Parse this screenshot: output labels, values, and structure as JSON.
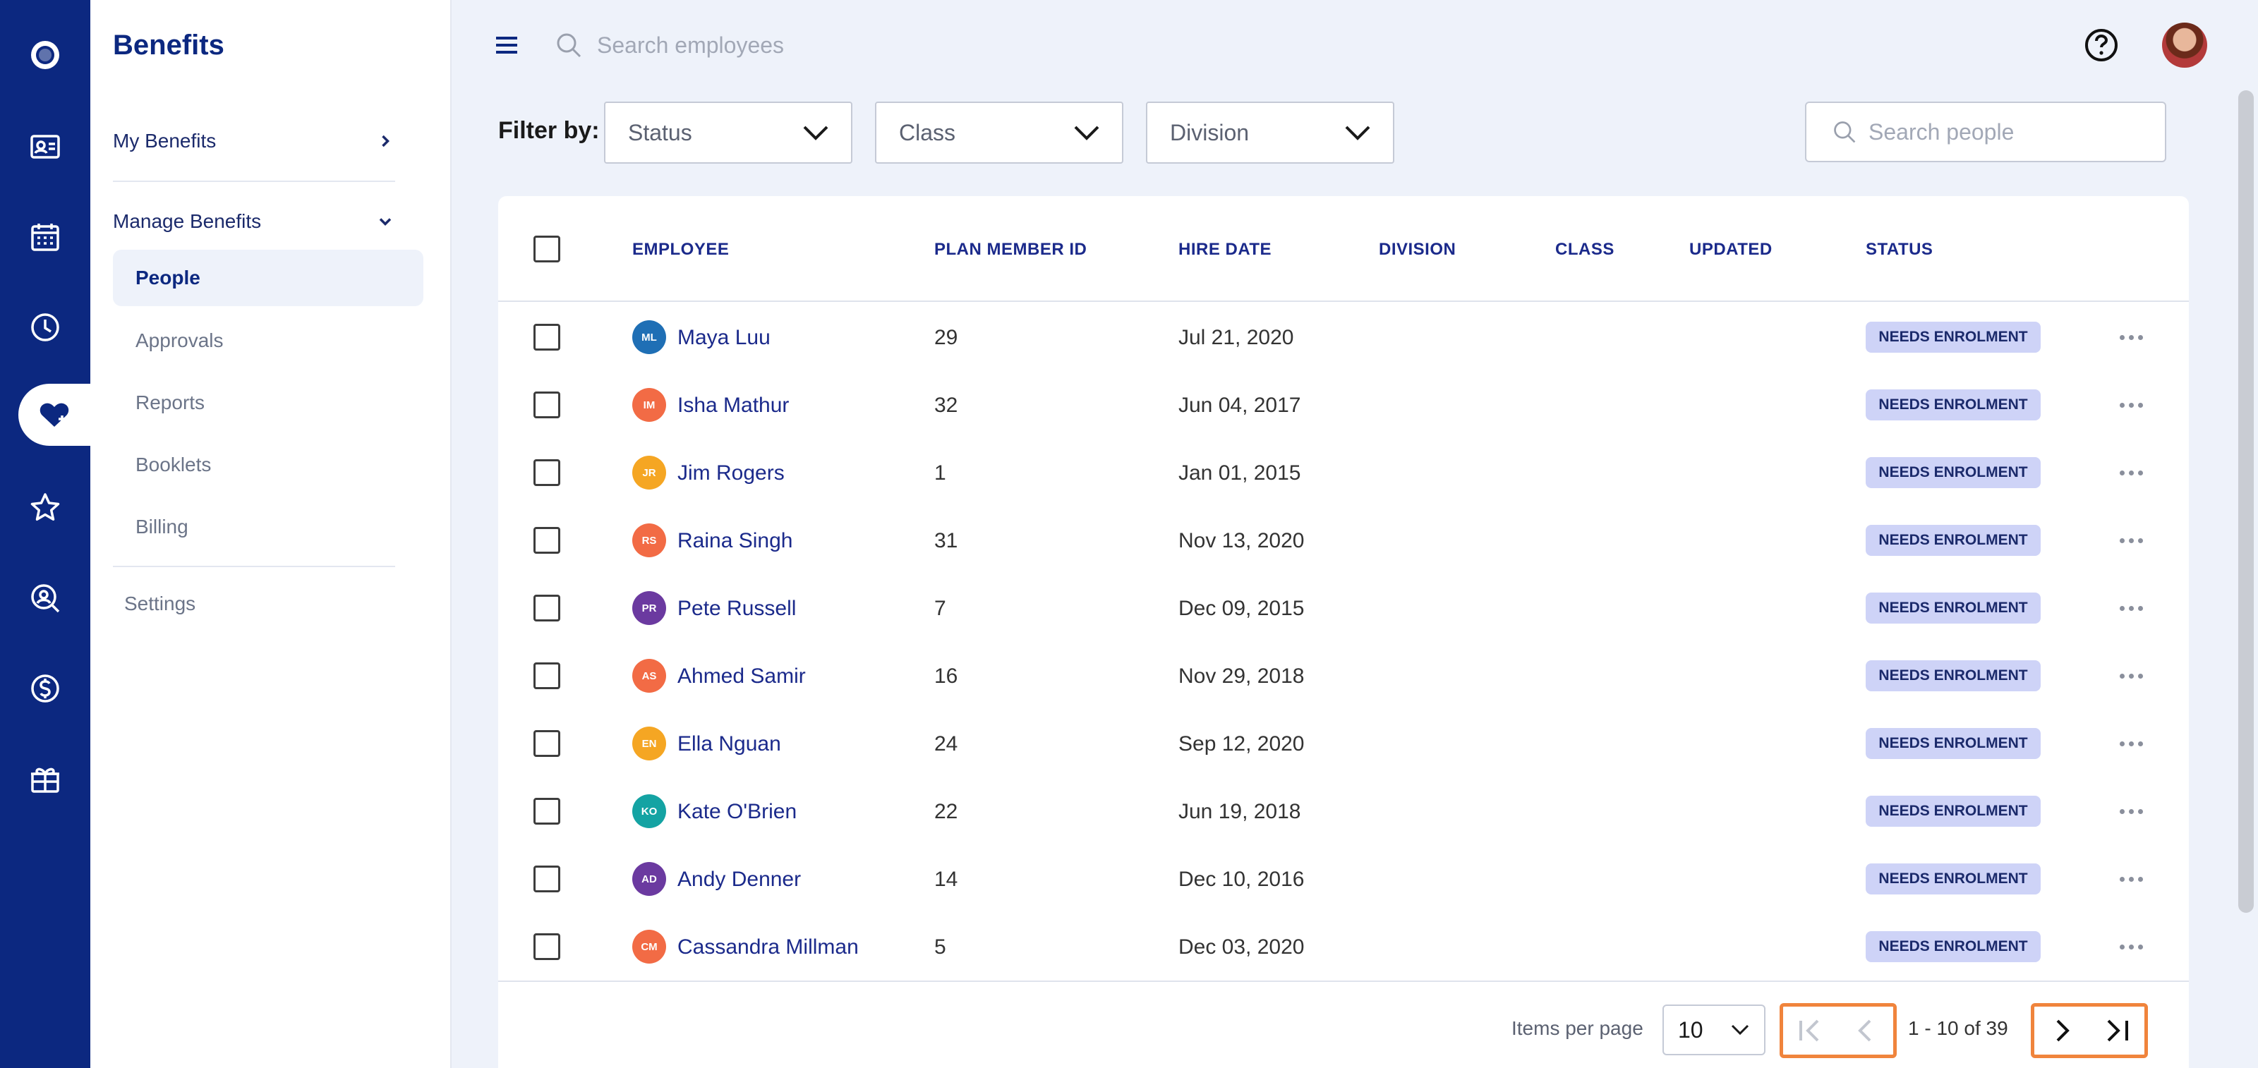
{
  "app": {
    "title": "Benefits"
  },
  "rail": {
    "items": [
      {
        "icon": "logo-circle-icon"
      },
      {
        "icon": "id-card-icon"
      },
      {
        "icon": "calendar-icon"
      },
      {
        "icon": "clock-icon"
      },
      {
        "icon": "heart-icon",
        "active": true
      },
      {
        "icon": "star-icon"
      },
      {
        "icon": "person-search-icon"
      },
      {
        "icon": "dollar-icon"
      },
      {
        "icon": "gift-box-icon"
      }
    ]
  },
  "sidebar": {
    "title": "Benefits",
    "my_benefits": "My Benefits",
    "manage_benefits": "Manage Benefits",
    "sub_items": [
      "People",
      "Approvals",
      "Reports",
      "Booklets",
      "Billing"
    ],
    "settings": "Settings"
  },
  "topbar": {
    "search_placeholder": "Search employees"
  },
  "filters": {
    "label": "Filter by:",
    "status": "Status",
    "class": "Class",
    "division": "Division",
    "search_placeholder": "Search people"
  },
  "table": {
    "headers": {
      "employee": "EMPLOYEE",
      "plan_member_id": "PLAN MEMBER ID",
      "hire_date": "HIRE DATE",
      "division": "DIVISION",
      "class": "CLASS",
      "updated": "UPDATED",
      "status": "STATUS"
    },
    "rows": [
      {
        "initials": "ML",
        "color": "#1f6fb5",
        "name": "Maya Luu",
        "id": "29",
        "hire_date": "Jul 21, 2020",
        "status": "NEEDS ENROLMENT"
      },
      {
        "initials": "IM",
        "color": "#f26b45",
        "name": "Isha Mathur",
        "id": "32",
        "hire_date": "Jun 04, 2017",
        "status": "NEEDS ENROLMENT"
      },
      {
        "initials": "JR",
        "color": "#f5a623",
        "name": "Jim Rogers",
        "id": "1",
        "hire_date": "Jan 01, 2015",
        "status": "NEEDS ENROLMENT"
      },
      {
        "initials": "RS",
        "color": "#f26b45",
        "name": "Raina Singh",
        "id": "31",
        "hire_date": "Nov 13, 2020",
        "status": "NEEDS ENROLMENT"
      },
      {
        "initials": "PR",
        "color": "#6b3aa0",
        "name": "Pete Russell",
        "id": "7",
        "hire_date": "Dec 09, 2015",
        "status": "NEEDS ENROLMENT"
      },
      {
        "initials": "AS",
        "color": "#f26b45",
        "name": "Ahmed Samir",
        "id": "16",
        "hire_date": "Nov 29, 2018",
        "status": "NEEDS ENROLMENT"
      },
      {
        "initials": "EN",
        "color": "#f5a623",
        "name": "Ella Nguan",
        "id": "24",
        "hire_date": "Sep 12, 2020",
        "status": "NEEDS ENROLMENT"
      },
      {
        "initials": "KO",
        "color": "#14a3a3",
        "name": "Kate O'Brien",
        "id": "22",
        "hire_date": "Jun 19, 2018",
        "status": "NEEDS ENROLMENT"
      },
      {
        "initials": "AD",
        "color": "#6b3aa0",
        "name": "Andy Denner",
        "id": "14",
        "hire_date": "Dec 10, 2016",
        "status": "NEEDS ENROLMENT"
      },
      {
        "initials": "CM",
        "color": "#f26b45",
        "name": "Cassandra Millman",
        "id": "5",
        "hire_date": "Dec 03, 2020",
        "status": "NEEDS ENROLMENT"
      }
    ]
  },
  "pagination": {
    "items_per_page_label": "Items per page",
    "items_per_page": "10",
    "range": "1 - 10 of 39",
    "highlight_color": "#f0843c"
  },
  "colors": {
    "brand": "#0c2880",
    "badge_bg": "#ced3f7",
    "background": "#eef2fa"
  }
}
